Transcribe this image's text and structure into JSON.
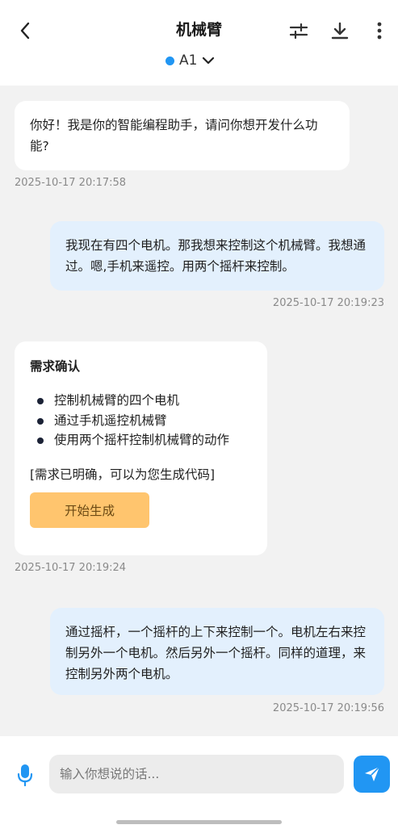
{
  "header": {
    "title": "机械臂",
    "device": {
      "label": "A1",
      "status_color": "#2196f3"
    },
    "icons": {
      "back": "chevron-left-icon",
      "settings": "sliders-icon",
      "download": "download-icon",
      "more": "more-vertical-icon"
    }
  },
  "messages": [
    {
      "role": "assistant",
      "text": "你好！我是你的智能编程助手，请问你想开发什么功能?",
      "time": "2025-10-17 20:17:58"
    },
    {
      "role": "user",
      "text": "我现在有四个电机。那我想来控制这个机械臂。我想通过。嗯,手机来遥控。用两个摇杆来控制。",
      "time": "2025-10-17 20:19:23"
    },
    {
      "role": "assistant",
      "card": {
        "title": "需求确认",
        "items": [
          "控制机械臂的四个电机",
          "通过手机遥控机械臂",
          "使用两个摇杆控制机械臂的动作"
        ],
        "note": "[需求已明确，可以为您生成代码]",
        "button_label": "开始生成"
      },
      "time": "2025-10-17 20:19:24"
    },
    {
      "role": "user",
      "text": "通过摇杆，一个摇杆的上下来控制一个。电机左右来控制另外一个电机。然后另外一个摇杆。同样的道理，来控制另外两个电机。",
      "time": "2025-10-17 20:19:56"
    }
  ],
  "input": {
    "placeholder": "输入你想说的话...",
    "value": ""
  },
  "colors": {
    "accent": "#2196f3",
    "user_bubble": "#e3f0fd",
    "generate_button": "#ffc56e",
    "chat_bg": "#f2f2f2"
  }
}
